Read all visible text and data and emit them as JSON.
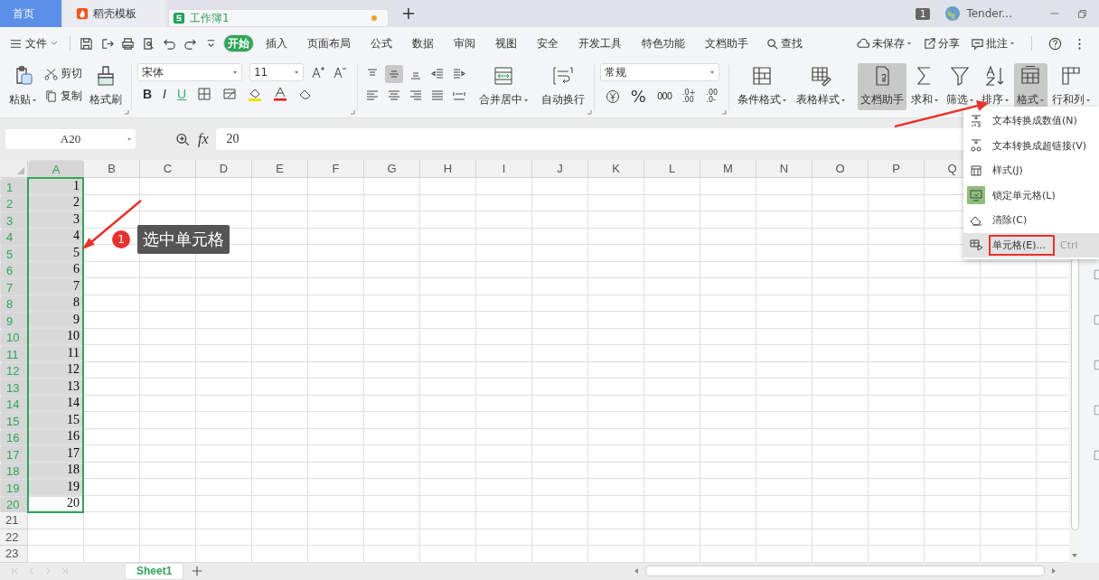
{
  "tabs": [
    {
      "label": "首页",
      "kind": "home",
      "selected": false,
      "modified": false
    },
    {
      "label": "稻壳模板",
      "kind": "docer",
      "selected": false,
      "modified": false
    },
    {
      "label": "工作簿1",
      "kind": "sheet",
      "selected": true,
      "modified": true
    }
  ],
  "account": {
    "badge": "1",
    "name": "Tender..."
  },
  "menu": {
    "file": "文件",
    "tabs": [
      {
        "label": "开始",
        "selected": true
      },
      {
        "label": "插入",
        "selected": false
      },
      {
        "label": "页面布局",
        "selected": false
      },
      {
        "label": "公式",
        "selected": false
      },
      {
        "label": "数据",
        "selected": false
      },
      {
        "label": "审阅",
        "selected": false
      },
      {
        "label": "视图",
        "selected": false
      },
      {
        "label": "安全",
        "selected": false
      },
      {
        "label": "开发工具",
        "selected": false
      },
      {
        "label": "特色功能",
        "selected": false
      },
      {
        "label": "文档助手",
        "selected": false
      }
    ],
    "search": "查找",
    "actions": [
      {
        "label": "未保存",
        "dropdown": true
      },
      {
        "label": "分享",
        "dropdown": false
      },
      {
        "label": "批注",
        "dropdown": true
      }
    ]
  },
  "ribbon": {
    "paste": "粘贴",
    "cut": "剪切",
    "copy": "复制",
    "format_painter": "格式刷",
    "font": "宋体",
    "size": "11",
    "styles": [
      "B",
      "I",
      "U"
    ],
    "alignment": [
      {
        "selected": false
      },
      {
        "selected": true
      },
      {
        "selected": false
      },
      {
        "selected": false
      },
      {
        "selected": false
      },
      {
        "selected": false
      },
      {
        "selected": false
      },
      {
        "selected": false
      },
      {
        "selected": false
      },
      {
        "selected": false
      }
    ],
    "merge": "合并居中",
    "wrap": "自动换行",
    "number_format": "常规",
    "percent": "%",
    "thousands": "000",
    "decimals": [
      {
        "top": ".0+",
        "bottom": ".00"
      },
      {
        "top": ".00",
        "bottom": ".0-"
      }
    ],
    "tools": [
      {
        "label": "条件格式",
        "dropdown": true,
        "active": false
      },
      {
        "label": "表格样式",
        "dropdown": true,
        "active": false
      },
      {
        "label": "文档助手",
        "dropdown": false,
        "active": true
      },
      {
        "label": "求和",
        "dropdown": true,
        "active": false
      },
      {
        "label": "筛选",
        "dropdown": true,
        "active": false
      },
      {
        "label": "排序",
        "dropdown": true,
        "active": false
      },
      {
        "label": "格式",
        "dropdown": true,
        "active": true
      },
      {
        "label": "行和列",
        "dropdown": true,
        "active": false
      }
    ]
  },
  "formula_bar": {
    "name_box": "A20",
    "fx": "fx",
    "value": "20"
  },
  "sheet": {
    "columns": [
      {
        "label": "A",
        "selected": true
      },
      {
        "label": "B",
        "selected": false
      },
      {
        "label": "C",
        "selected": false
      },
      {
        "label": "D",
        "selected": false
      },
      {
        "label": "E",
        "selected": false
      },
      {
        "label": "F",
        "selected": false
      },
      {
        "label": "G",
        "selected": false
      },
      {
        "label": "H",
        "selected": false
      },
      {
        "label": "I",
        "selected": false
      },
      {
        "label": "J",
        "selected": false
      },
      {
        "label": "K",
        "selected": false
      },
      {
        "label": "L",
        "selected": false
      },
      {
        "label": "M",
        "selected": false
      },
      {
        "label": "N",
        "selected": false
      },
      {
        "label": "O",
        "selected": false
      },
      {
        "label": "P",
        "selected": false
      },
      {
        "label": "Q",
        "selected": false
      }
    ],
    "rows": [
      {
        "label": "1",
        "value": "1",
        "selected": true,
        "active": false
      },
      {
        "label": "2",
        "value": "2",
        "selected": true,
        "active": false
      },
      {
        "label": "3",
        "value": "3",
        "selected": true,
        "active": false
      },
      {
        "label": "4",
        "value": "4",
        "selected": true,
        "active": false
      },
      {
        "label": "5",
        "value": "5",
        "selected": true,
        "active": false
      },
      {
        "label": "6",
        "value": "6",
        "selected": true,
        "active": false
      },
      {
        "label": "7",
        "value": "7",
        "selected": true,
        "active": false
      },
      {
        "label": "8",
        "value": "8",
        "selected": true,
        "active": false
      },
      {
        "label": "9",
        "value": "9",
        "selected": true,
        "active": false
      },
      {
        "label": "10",
        "value": "10",
        "selected": true,
        "active": false
      },
      {
        "label": "11",
        "value": "11",
        "selected": true,
        "active": false
      },
      {
        "label": "12",
        "value": "12",
        "selected": true,
        "active": false
      },
      {
        "label": "13",
        "value": "13",
        "selected": true,
        "active": false
      },
      {
        "label": "14",
        "value": "14",
        "selected": true,
        "active": false
      },
      {
        "label": "15",
        "value": "15",
        "selected": true,
        "active": false
      },
      {
        "label": "16",
        "value": "16",
        "selected": true,
        "active": false
      },
      {
        "label": "17",
        "value": "17",
        "selected": true,
        "active": false
      },
      {
        "label": "18",
        "value": "18",
        "selected": true,
        "active": false
      },
      {
        "label": "19",
        "value": "19",
        "selected": true,
        "active": false
      },
      {
        "label": "20",
        "value": "20",
        "selected": true,
        "active": true
      },
      {
        "label": "21",
        "selected": false
      },
      {
        "label": "22",
        "selected": false
      },
      {
        "label": "23",
        "selected": false
      }
    ]
  },
  "callout": {
    "number": "1",
    "text": "选中单元格"
  },
  "context_menu": {
    "items": [
      {
        "label": "文本转换成数值(N)",
        "checked": false,
        "hovered": false,
        "highlighted": false
      },
      {
        "label": "文本转换成超链接(V)",
        "checked": false,
        "hovered": false,
        "highlighted": false
      },
      {
        "label": "样式(J)",
        "checked": false,
        "hovered": false,
        "highlighted": false
      },
      {
        "label": "锁定单元格(L)",
        "checked": true,
        "hovered": false,
        "highlighted": false
      },
      {
        "label": "清除(C)",
        "checked": false,
        "hovered": false,
        "highlighted": false
      },
      {
        "label": "单元格(E)...",
        "shortcut": "Ctrl",
        "checked": false,
        "hovered": true,
        "highlighted": true
      }
    ]
  },
  "sheet_tabs": [
    {
      "label": "Sheet1",
      "selected": true
    }
  ]
}
